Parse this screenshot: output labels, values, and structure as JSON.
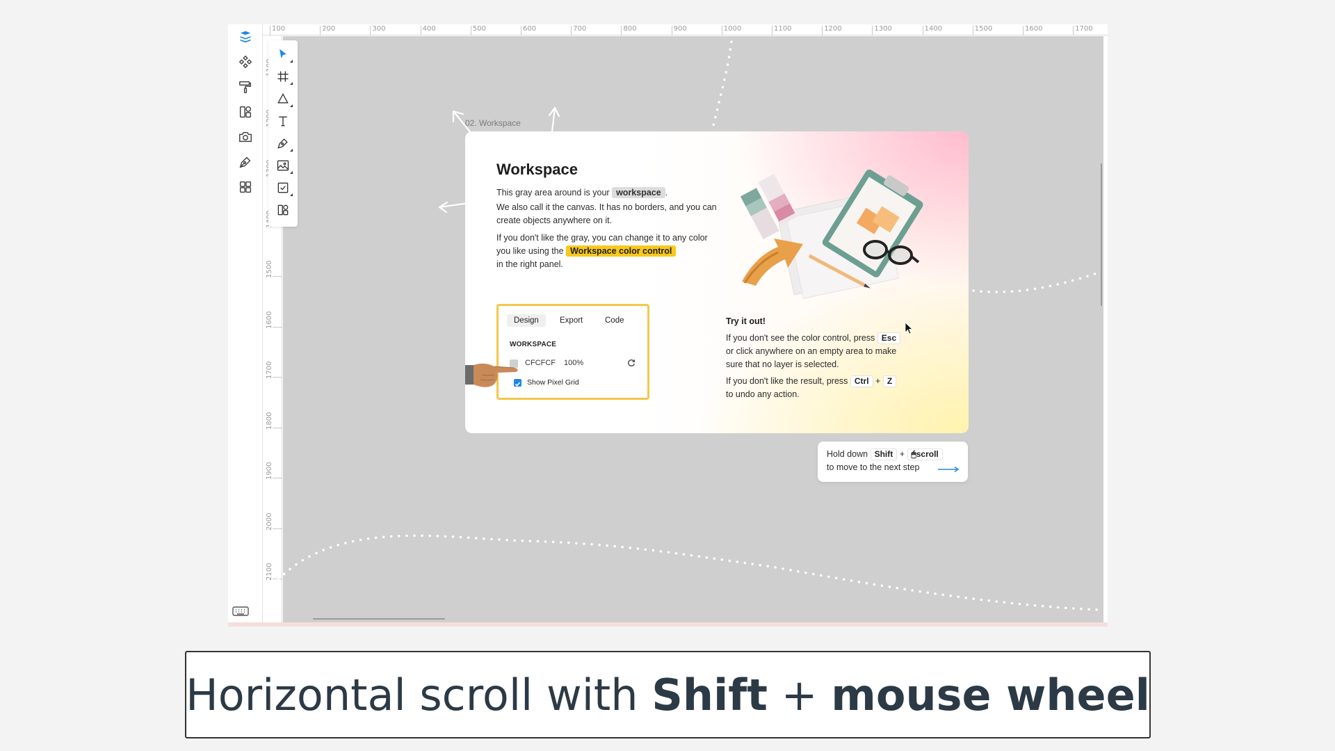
{
  "frame_label": "02. Workspace",
  "card": {
    "title": "Workspace",
    "para1_prefix": "This gray area around is your",
    "para1_chip": "workspace",
    "para1_suffix": ".",
    "para2_line1": "We also call it the canvas. It has no borders, and you can",
    "para2_line2": "create objects anywhere on it.",
    "para3_line1": "If you don't like the gray, you can change it to any color",
    "para3_line2_prefix": "you like using the",
    "para3_chip": "Workspace color control",
    "para3_line3": "in the right panel.",
    "try_title": "Try it out!",
    "try1_line1_prefix": "If you don't see the color control, press",
    "try1_key": "Esc",
    "try1_line2": "or click anywhere on an empty area to make",
    "try1_line3": "sure that no layer is selected.",
    "try2_prefix": "If you don't like the result, press",
    "try2_key1": "Ctrl",
    "try2_plus": "+",
    "try2_key2": "Z",
    "try2_line2": "to undo any action."
  },
  "demo_panel": {
    "tabs": [
      "Design",
      "Export",
      "Code"
    ],
    "section": "WORKSPACE",
    "hex": "CFCFCF",
    "opacity": "100%",
    "checkbox_label": "Show Pixel Grid"
  },
  "hint": {
    "line1_prefix": "Hold down",
    "key_shift": "Shift",
    "plus": "+",
    "key_scroll": "🖱scroll",
    "line2": "to move to the next step"
  },
  "ruler": {
    "top": [
      "100",
      "200",
      "300",
      "400",
      "500",
      "600",
      "700",
      "800",
      "900",
      "1000",
      "1100",
      "1200",
      "1300",
      "1400",
      "1500",
      "1600",
      "1700"
    ],
    "left": [
      "1100",
      "1200",
      "1300",
      "1400",
      "1500",
      "1600",
      "1700",
      "1800",
      "1900",
      "2000",
      "2100"
    ]
  },
  "caption": {
    "normal1": "Horizontal scroll with ",
    "bold1": "Shift",
    "normal2": " + ",
    "bold2": "mouse wheel"
  },
  "colors": {
    "canvas": "#cfcfcf",
    "accent_blue": "#1e88e5",
    "highlight_yellow": "#f8c81c",
    "panel_border": "#f6c64a"
  },
  "icons": {
    "left_bar": [
      "layers-icon",
      "components-icon",
      "paint-roller-icon",
      "assets-icon",
      "camera-icon",
      "pen-icon",
      "plugins-icon"
    ],
    "toolbar": [
      "move-tool-icon",
      "frame-tool-icon",
      "shape-tool-icon",
      "text-tool-icon",
      "pen-tool-icon",
      "image-tool-icon",
      "checkbox-tool-icon",
      "widget-tool-icon"
    ]
  }
}
